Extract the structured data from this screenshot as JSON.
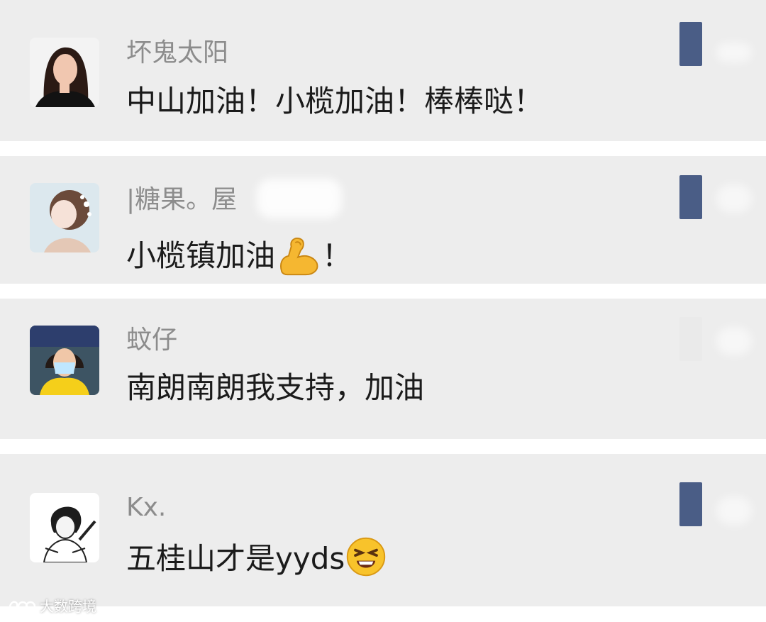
{
  "comments": [
    {
      "username": "坏鬼太阳",
      "message": "中山加油！小榄加油！棒棒哒！",
      "avatar_icon": "woman-photo-avatar-icon",
      "like_icon": "like-icon"
    },
    {
      "username": "|糖果。屋",
      "message": "小榄镇加油",
      "message_suffix": "！",
      "emoji": "flexed-biceps-emoji",
      "avatar_icon": "illustrated-girl-avatar-icon",
      "like_icon": "like-icon"
    },
    {
      "username": "蚊仔",
      "message": "南朗南朗我支持，加油",
      "avatar_icon": "masked-person-avatar-icon",
      "like_icon": "like-icon"
    },
    {
      "username": "Kx.",
      "message": "五桂山才是yyds",
      "emoji": "laughing-squinting-emoji",
      "avatar_icon": "manga-sketch-avatar-icon",
      "like_icon": "like-icon"
    }
  ],
  "watermark": {
    "text": "大数跨境",
    "icon": "brand-logo-icon"
  }
}
